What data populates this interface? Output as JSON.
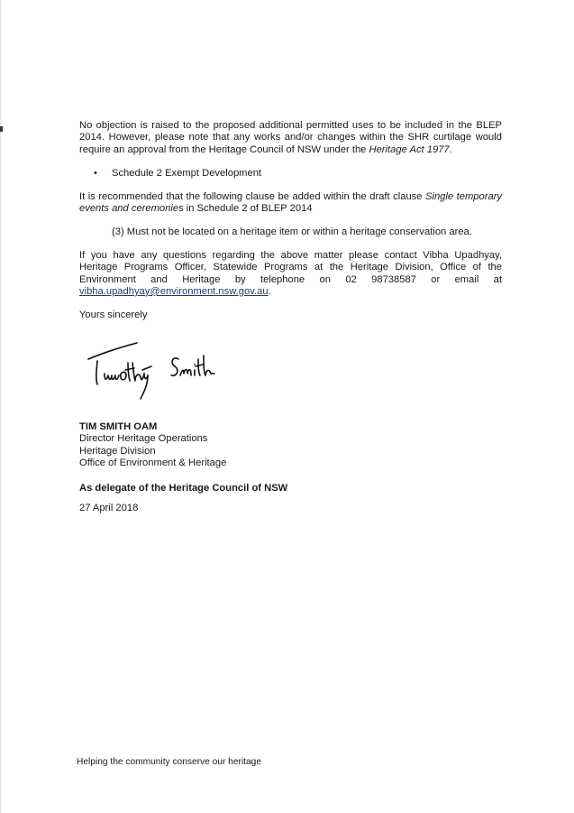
{
  "letter": {
    "paragraph1": {
      "text_a": "No objection is raised to the proposed additional permitted uses to be included in the BLEP 2014. However, please note that any works and/or changes within the SHR curtilage would require an approval from the Heritage Council of NSW under the ",
      "italic": "Heritage Act 1977",
      "text_b": "."
    },
    "bullet": {
      "symbol": "•",
      "text": "Schedule 2 Exempt Development"
    },
    "paragraph2": {
      "text_a": "It is recommended that the following clause be added within the draft clause ",
      "italic": "Single temporary events and ceremonies",
      "text_b": " in Schedule 2 of BLEP 2014"
    },
    "clause": "(3) Must not be located on a heritage item or within a heritage conservation area.",
    "paragraph3": {
      "text": "If you have any questions regarding the above matter please contact Vibha Upadhyay, Heritage Programs Officer, Statewide Programs at the Heritage Division, Office of the Environment and Heritage by telephone on 02 98738587 or email at",
      "email": "vibha.upadhyay@environment.nsw.gov.au",
      "after_email": "."
    },
    "closing": "Yours sincerely",
    "signature_icon": "handwritten-signature",
    "signatory": {
      "name": "TIM SMITH OAM",
      "title": "Director Heritage Operations",
      "division": "Heritage Division",
      "office": "Office of Environment & Heritage"
    },
    "delegate": "As delegate of the Heritage Council of NSW",
    "date": "27 April 2018"
  },
  "footer": {
    "tagline": "Helping the community conserve our heritage"
  }
}
